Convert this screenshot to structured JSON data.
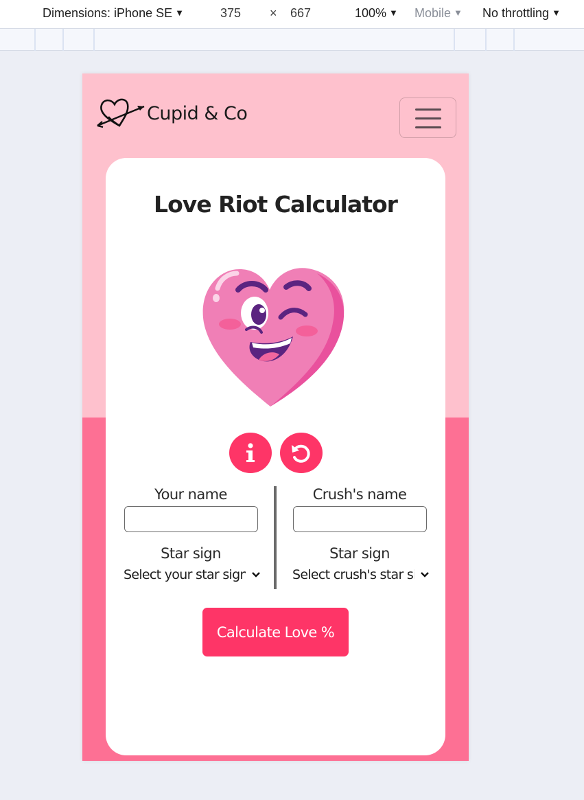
{
  "devtools": {
    "dimensions_label": "Dimensions: iPhone SE",
    "width": "375",
    "times": "×",
    "height": "667",
    "zoom": "100%",
    "device_type": "Mobile",
    "throttling": "No throttling"
  },
  "navbar": {
    "brand_name": "Cupid & Co",
    "logo_icon": "heart-arrow-icon",
    "menu_icon": "hamburger-icon"
  },
  "calculator": {
    "title": "Love Riot Calculator",
    "illustration": "winking-heart-icon",
    "info_icon": "info-icon",
    "reset_icon": "reset-icon",
    "your_name_label": "Your name",
    "your_name_value": "",
    "crush_name_label": "Crush's name",
    "crush_name_value": "",
    "your_sign_label": "Star sign",
    "your_sign_selected": "Select your star sign",
    "crush_sign_label": "Star sign",
    "crush_sign_selected": "Select crush's star sign",
    "calculate_label": "Calculate Love %"
  },
  "colors": {
    "background_top": "#fec1cd",
    "background_bottom": "#fd7094",
    "accent": "#fe3567",
    "card": "#ffffff"
  }
}
